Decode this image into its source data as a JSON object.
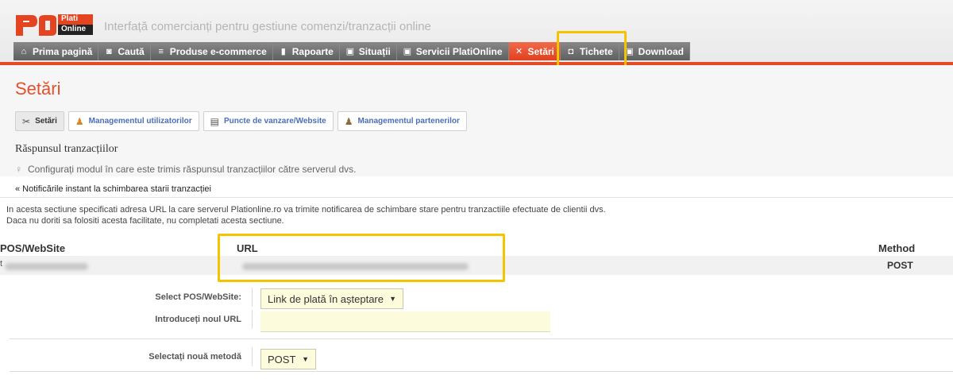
{
  "header": {
    "logo_text_top": "Plati",
    "logo_text_bottom": "Online",
    "tagline": "Interfață comercianți pentru gestiune comenzi/tranzacții online"
  },
  "nav": {
    "items": [
      {
        "label": "Prima pagină",
        "icon": "home-icon"
      },
      {
        "label": "Caută",
        "icon": "search-icon"
      },
      {
        "label": "Produse e-commerce",
        "icon": "list-icon"
      },
      {
        "label": "Rapoarte",
        "icon": "bar-chart-icon"
      },
      {
        "label": "Situații",
        "icon": "report-icon"
      },
      {
        "label": "Servicii PlatiOnline",
        "icon": "services-icon"
      },
      {
        "label": "Setări",
        "icon": "tools-icon",
        "active": true
      },
      {
        "label": "Tichete",
        "icon": "ticket-icon"
      },
      {
        "label": "Download",
        "icon": "download-icon"
      }
    ]
  },
  "page": {
    "title": "Setări",
    "subtabs": [
      {
        "label": "Setări",
        "icon": "tools-icon",
        "active": true
      },
      {
        "label": "Managementul utilizatorilor",
        "icon": "user-icon"
      },
      {
        "label": "Puncte de vanzare/Website",
        "icon": "document-icon"
      },
      {
        "label": "Managementul partenerilor",
        "icon": "partners-icon"
      }
    ],
    "section_title": "Răspunsul tranzacțiilor",
    "hint": "Configurați modul în care este trimis răspunsul tranzacțiilor către serverul dvs.",
    "notification_link": "« Notificările instant la schimbarea starii tranzacției",
    "description_line1": "In acesta sectiune specificati adresa URL la care serverul Plationline.ro va trimite notificarea de schimbare stare pentru tranzactiile efectuate de clientii dvs.",
    "description_line2": "Daca nu doriti sa folositi acesta facilitate, nu completati acesta sectiune."
  },
  "table": {
    "col_pos": "POS/WebSite",
    "col_url": "URL",
    "col_method": "Method",
    "row": {
      "pos": "t",
      "method": "POST"
    }
  },
  "form": {
    "select_pos_label": "Select POS/WebSite:",
    "select_pos_value": "Link de plată în așteptare",
    "new_url_label": "Introduceți noul URL",
    "new_url_value": "",
    "method_label": "Selectați nouă metodă",
    "method_value": "POST"
  },
  "colors": {
    "accent": "#e4502e",
    "nav_bg": "#6b6b6b",
    "highlight": "#f5c400",
    "field_bg": "#fcfcdc"
  }
}
